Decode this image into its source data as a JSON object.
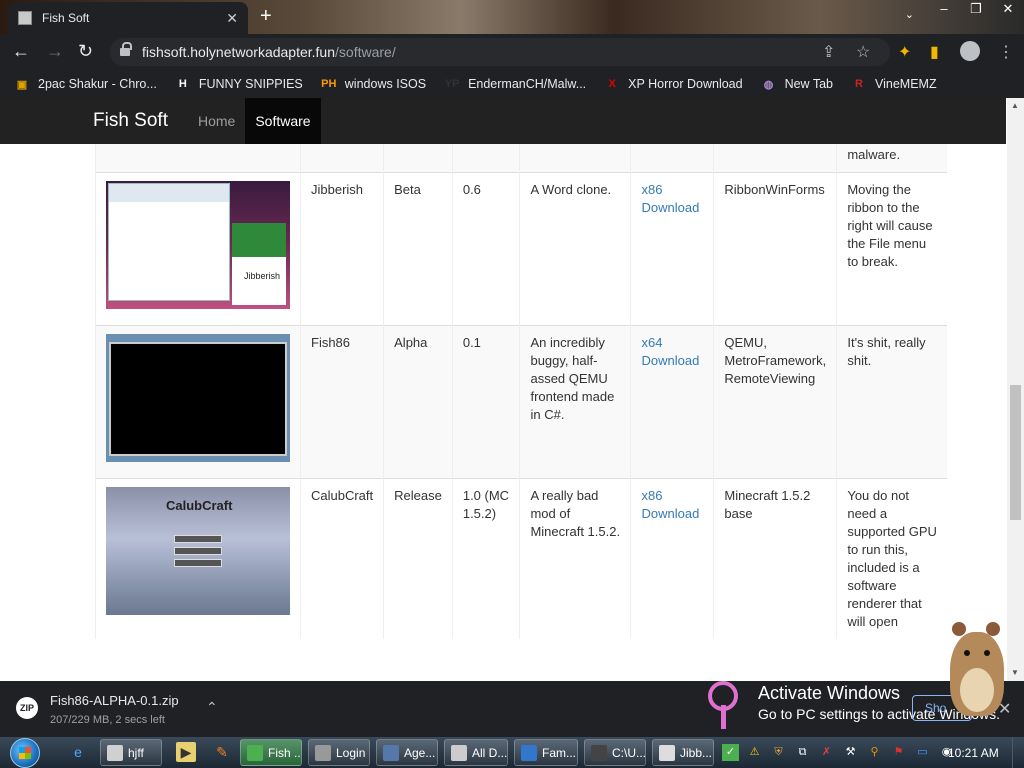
{
  "browser": {
    "tab_title": "Fish Soft",
    "url_host": "fishsoft.holynetworkadapter.fun",
    "url_path": "/software/",
    "bookmarks": [
      {
        "label": "2pac Shakur - Chro...",
        "icon": "bookmark-icon",
        "color": "#e0a000"
      },
      {
        "label": "FUNNY SNIPPIES",
        "icon": "H",
        "color": "#ffffff"
      },
      {
        "label": "windows ISOS",
        "icon": "PH",
        "color": "#ff9900"
      },
      {
        "label": "EndermanCH/Malw...",
        "icon": "YP",
        "color": "#333333"
      },
      {
        "label": "XP Horror Download",
        "icon": "X",
        "color": "#e00000"
      },
      {
        "label": "New Tab",
        "icon": "globe-icon",
        "color": "#aa88cc"
      },
      {
        "label": "VineMEMZ",
        "icon": "R",
        "color": "#cc2222"
      }
    ]
  },
  "site": {
    "brand": "Fish Soft",
    "nav": [
      {
        "label": "Home",
        "active": false
      },
      {
        "label": "Software",
        "active": true
      }
    ]
  },
  "table": {
    "rows": [
      {
        "name": "",
        "status": "",
        "version": "",
        "description": "",
        "download": "",
        "deps": "",
        "notes": "scanner, and did not report any form of malware."
      },
      {
        "name": "Jibberish",
        "status": "Beta",
        "version": "0.6",
        "description": "A Word clone.",
        "download": "x86 Download",
        "deps": "RibbonWinForms",
        "notes": "Moving the ribbon to the right will cause the File menu to break.",
        "thumb_label": "Jibberish"
      },
      {
        "name": "Fish86",
        "status": "Alpha",
        "version": "0.1",
        "description": "An incredibly buggy, half-assed QEMU frontend made in C#.",
        "download": "x64 Download",
        "deps": "QEMU, MetroFramework, RemoteViewing",
        "notes": "It's shit, really shit."
      },
      {
        "name": "CalubCraft",
        "status": "Release",
        "version": "1.0 (MC 1.5.2)",
        "description": "A really bad mod of Minecraft 1.5.2.",
        "download": "x86 Download",
        "deps": "Minecraft 1.5.2 base",
        "notes": "You do not need a supported GPU to run this, included is a software renderer that will open",
        "thumb_label": "CalubCraft"
      }
    ]
  },
  "downloads": {
    "file": "Fish86-ALPHA-0.1.zip",
    "progress": "207/229 MB, 2 secs left",
    "show_all": "Sho"
  },
  "watermark": {
    "title": "Activate Windows",
    "subtitle": "Go to PC settings to activate Windows."
  },
  "taskbar": {
    "buttons": [
      {
        "label": "hjff",
        "color": "#d0d0d0"
      },
      {
        "label": "Fish ...",
        "color": "#4caf50",
        "active": true
      },
      {
        "label": "Login",
        "color": "#999999"
      },
      {
        "label": "Age...",
        "color": "#5577aa"
      },
      {
        "label": "All D...",
        "color": "#cccccc"
      },
      {
        "label": "Fam...",
        "color": "#3377cc"
      },
      {
        "label": "C:\\U...",
        "color": "#444444"
      },
      {
        "label": "Jibb...",
        "color": "#dddddd"
      }
    ],
    "clock": "10:21 AM"
  }
}
